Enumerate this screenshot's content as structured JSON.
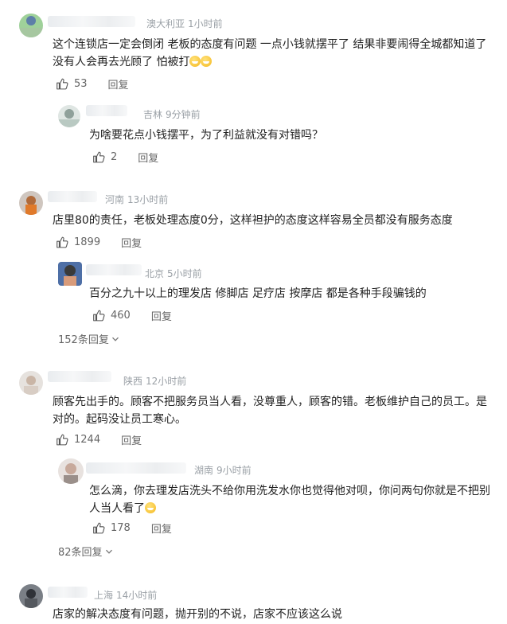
{
  "comments": [
    {
      "region": "澳大利亚",
      "time": "1小时前",
      "text_line1": "这个连锁店一定会倒闭 老板的态度有问题 一点小钱就摆平了 结果非要闹得全城都知道了",
      "text_line2": "没有人会再去光顾了 怕被打",
      "likes": "53",
      "reply_label": "回复"
    },
    {
      "region": "吉林",
      "time": "9分钟前",
      "text": "为啥要花点小钱摆平，为了利益就没有对错吗？",
      "likes": "2",
      "reply_label": "回复"
    },
    {
      "region": "河南",
      "time": "13小时前",
      "text": "店里80的责任，老板处理态度0分，这样袒护的态度这样容易全员都没有服务态度",
      "likes": "1899",
      "reply_label": "回复"
    },
    {
      "region": "北京",
      "time": "5小时前",
      "text": "百分之九十以上的理发店 修脚店 足疗店 按摩店 都是各种手段骗钱的",
      "likes": "460",
      "reply_label": "回复"
    },
    {
      "region": "陕西",
      "time": "12小时前",
      "text_line1": "顾客先出手的。顾客不把服务员当人看，没尊重人，顾客的错。老板维护自己的员工。是",
      "text_line2": "对的。起码没让员工寒心。",
      "likes": "1244",
      "reply_label": "回复"
    },
    {
      "region": "湖南",
      "time": "9小时前",
      "text_line1": "怎么滴，你去理发店洗头不给你用洗发水你也觉得他对呗，你问两句你就是不把别",
      "text_line2": "人当人看了",
      "likes": "178",
      "reply_label": "回复"
    },
    {
      "region": "上海",
      "time": "14小时前",
      "text": "店家的解决态度有问题，抛开别的不说，店家不应该这么说"
    }
  ],
  "more_replies_1": "152条回复",
  "more_replies_2": "82条回复",
  "colors": {
    "meta": "#9aa0a6",
    "text": "#222222",
    "action": "#666666"
  },
  "icons": {
    "like": "thumbs-up-icon",
    "expand": "chevron-down-icon",
    "emoji": "grin-emoji-icon"
  }
}
